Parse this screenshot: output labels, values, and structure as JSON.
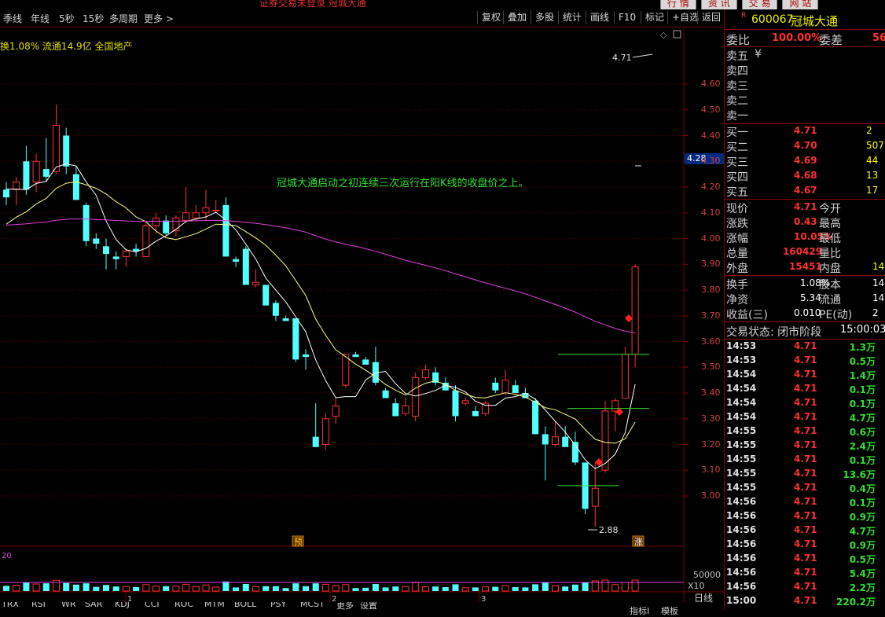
{
  "window": {
    "title": "证券交易未登录 冠城大通",
    "tabs": [
      "行 情",
      "资 讯",
      "交 易",
      "网 站"
    ]
  },
  "toolbar": {
    "periods": [
      "季线",
      "年线",
      "5秒",
      "15秒",
      "多周期",
      "更多 >"
    ],
    "buttons": [
      "复权",
      "叠加",
      "多股",
      "统计",
      "画线",
      "F10",
      "标记",
      "+自选",
      "返回"
    ]
  },
  "info_line": "换1.08% 流通14.9亿 全国地产",
  "annotation": "冠城大通启动之初连续三次运行在阳K线的收盘价之上。",
  "chart_data": {
    "type": "candlestick",
    "price_axis_ticks": [
      "4.60",
      "4.50",
      "4.40",
      "4.30",
      "4.20",
      "4.10",
      "4.00",
      "3.90",
      "3.80",
      "3.70",
      "3.60",
      "3.50",
      "3.40",
      "3.30",
      "3.20",
      "3.10",
      "3.00"
    ],
    "ylim": [
      2.85,
      4.72
    ],
    "current_price_label": "4.28",
    "high_marker": "4.71",
    "low_marker": "2.88",
    "candles": [
      {
        "o": 4.19,
        "h": 4.22,
        "l": 4.13,
        "c": 4.16
      },
      {
        "o": 4.19,
        "h": 4.24,
        "l": 4.13,
        "c": 4.22
      },
      {
        "o": 4.3,
        "h": 4.36,
        "l": 4.17,
        "c": 4.19
      },
      {
        "o": 4.22,
        "h": 4.33,
        "l": 4.18,
        "c": 4.3
      },
      {
        "o": 4.27,
        "h": 4.39,
        "l": 4.22,
        "c": 4.24
      },
      {
        "o": 4.26,
        "h": 4.52,
        "l": 4.25,
        "c": 4.44
      },
      {
        "o": 4.4,
        "h": 4.43,
        "l": 4.25,
        "c": 4.28
      },
      {
        "o": 4.25,
        "h": 4.28,
        "l": 4.15,
        "c": 4.15
      },
      {
        "o": 4.13,
        "h": 4.14,
        "l": 3.97,
        "c": 3.99
      },
      {
        "o": 4.0,
        "h": 4.02,
        "l": 3.96,
        "c": 3.98
      },
      {
        "o": 3.97,
        "h": 4.0,
        "l": 3.88,
        "c": 3.94
      },
      {
        "o": 3.93,
        "h": 3.95,
        "l": 3.88,
        "c": 3.92
      },
      {
        "o": 3.93,
        "h": 3.96,
        "l": 3.89,
        "c": 3.95
      },
      {
        "o": 3.96,
        "h": 3.98,
        "l": 3.93,
        "c": 3.95
      },
      {
        "o": 3.93,
        "h": 4.06,
        "l": 3.93,
        "c": 4.05
      },
      {
        "o": 4.05,
        "h": 4.1,
        "l": 4.02,
        "c": 4.08
      },
      {
        "o": 4.07,
        "h": 4.09,
        "l": 4.01,
        "c": 4.02
      },
      {
        "o": 4.03,
        "h": 4.09,
        "l": 4.01,
        "c": 4.08
      },
      {
        "o": 4.07,
        "h": 4.2,
        "l": 4.06,
        "c": 4.1
      },
      {
        "o": 4.08,
        "h": 4.13,
        "l": 4.07,
        "c": 4.1
      },
      {
        "o": 4.1,
        "h": 4.19,
        "l": 4.07,
        "c": 4.12
      },
      {
        "o": 4.11,
        "h": 4.15,
        "l": 4.1,
        "c": 4.11
      },
      {
        "o": 4.13,
        "h": 4.16,
        "l": 3.93,
        "c": 3.93
      },
      {
        "o": 3.92,
        "h": 3.93,
        "l": 3.89,
        "c": 3.91
      },
      {
        "o": 3.96,
        "h": 3.97,
        "l": 3.82,
        "c": 3.82
      },
      {
        "o": 3.82,
        "h": 3.88,
        "l": 3.81,
        "c": 3.83
      },
      {
        "o": 3.82,
        "h": 3.82,
        "l": 3.74,
        "c": 3.74
      },
      {
        "o": 3.75,
        "h": 3.76,
        "l": 3.68,
        "c": 3.7
      },
      {
        "o": 3.69,
        "h": 3.7,
        "l": 3.68,
        "c": 3.68
      },
      {
        "o": 3.69,
        "h": 3.69,
        "l": 3.52,
        "c": 3.53
      },
      {
        "o": 3.55,
        "h": 3.57,
        "l": 3.49,
        "c": 3.54
      },
      {
        "o": 3.23,
        "h": 3.36,
        "l": 3.19,
        "c": 3.19
      },
      {
        "o": 3.2,
        "h": 3.32,
        "l": 3.18,
        "c": 3.3
      },
      {
        "o": 3.31,
        "h": 3.38,
        "l": 3.28,
        "c": 3.35
      },
      {
        "o": 3.43,
        "h": 3.55,
        "l": 3.42,
        "c": 3.55
      },
      {
        "o": 3.55,
        "h": 3.56,
        "l": 3.54,
        "c": 3.54
      },
      {
        "o": 3.53,
        "h": 3.54,
        "l": 3.51,
        "c": 3.51
      },
      {
        "o": 3.52,
        "h": 3.58,
        "l": 3.43,
        "c": 3.44
      },
      {
        "o": 3.41,
        "h": 3.42,
        "l": 3.38,
        "c": 3.38
      },
      {
        "o": 3.36,
        "h": 3.38,
        "l": 3.31,
        "c": 3.31
      },
      {
        "o": 3.32,
        "h": 3.38,
        "l": 3.31,
        "c": 3.35
      },
      {
        "o": 3.31,
        "h": 3.48,
        "l": 3.29,
        "c": 3.46
      },
      {
        "o": 3.46,
        "h": 3.51,
        "l": 3.45,
        "c": 3.49
      },
      {
        "o": 3.48,
        "h": 3.5,
        "l": 3.43,
        "c": 3.44
      },
      {
        "o": 3.44,
        "h": 3.46,
        "l": 3.41,
        "c": 3.41
      },
      {
        "o": 3.41,
        "h": 3.43,
        "l": 3.29,
        "c": 3.31
      },
      {
        "o": 3.36,
        "h": 3.38,
        "l": 3.35,
        "c": 3.37
      },
      {
        "o": 3.33,
        "h": 3.35,
        "l": 3.31,
        "c": 3.31
      },
      {
        "o": 3.32,
        "h": 3.37,
        "l": 3.31,
        "c": 3.36
      },
      {
        "o": 3.44,
        "h": 3.46,
        "l": 3.4,
        "c": 3.41
      },
      {
        "o": 3.4,
        "h": 3.49,
        "l": 3.39,
        "c": 3.45
      },
      {
        "o": 3.43,
        "h": 3.45,
        "l": 3.4,
        "c": 3.4
      },
      {
        "o": 3.4,
        "h": 3.42,
        "l": 3.38,
        "c": 3.38
      },
      {
        "o": 3.37,
        "h": 3.38,
        "l": 3.24,
        "c": 3.24
      },
      {
        "o": 3.24,
        "h": 3.27,
        "l": 3.06,
        "c": 3.2
      },
      {
        "o": 3.2,
        "h": 3.29,
        "l": 3.19,
        "c": 3.23
      },
      {
        "o": 3.23,
        "h": 3.27,
        "l": 3.2,
        "c": 3.19
      },
      {
        "o": 3.21,
        "h": 3.25,
        "l": 3.12,
        "c": 3.13
      },
      {
        "o": 3.13,
        "h": 3.13,
        "l": 2.93,
        "c": 2.95
      },
      {
        "o": 2.96,
        "h": 3.13,
        "l": 2.88,
        "c": 3.03
      },
      {
        "o": 3.1,
        "h": 3.37,
        "l": 3.09,
        "c": 3.33
      },
      {
        "o": 3.33,
        "h": 3.38,
        "l": 3.25,
        "c": 3.37
      },
      {
        "o": 3.38,
        "h": 3.58,
        "l": 3.38,
        "c": 3.55
      },
      {
        "o": 3.55,
        "h": 3.9,
        "l": 3.5,
        "c": 3.89
      }
    ],
    "moving_averages": [
      {
        "name": "MA5",
        "color": "#ffffff"
      },
      {
        "name": "MA10",
        "color": "#ffff80"
      },
      {
        "name": "MA60",
        "color": "#e040e0"
      }
    ],
    "volume": {
      "ticks": [
        "50000",
        "X10"
      ],
      "label": "20"
    },
    "date_marks": [
      "1",
      "2",
      "3"
    ]
  },
  "markers": {
    "pre_label": "预",
    "rise_label": "涨"
  },
  "quote_panel": {
    "code": "600067",
    "name": "冠城大通",
    "r_mark": "R",
    "weibi": {
      "label": "委比",
      "value": "100.00%",
      "label2": "委差",
      "value2": "56"
    },
    "sell": [
      {
        "label": "卖五",
        "price": "¥",
        "vol": ""
      },
      {
        "label": "卖四",
        "price": "",
        "vol": ""
      },
      {
        "label": "卖三",
        "price": "",
        "vol": ""
      },
      {
        "label": "卖二",
        "price": "",
        "vol": ""
      },
      {
        "label": "卖一",
        "price": "",
        "vol": ""
      }
    ],
    "buy": [
      {
        "label": "买一",
        "price": "4.71",
        "vol": "2"
      },
      {
        "label": "买二",
        "price": "4.70",
        "vol": "507"
      },
      {
        "label": "买三",
        "price": "4.69",
        "vol": "44"
      },
      {
        "label": "买四",
        "price": "4.68",
        "vol": "13"
      },
      {
        "label": "买五",
        "price": "4.67",
        "vol": "17"
      }
    ],
    "stats": [
      {
        "k1": "现价",
        "v1": "4.71",
        "k2": "今开",
        "v2": ""
      },
      {
        "k1": "涨跌",
        "v1": "0.43",
        "k2": "最高",
        "v2": ""
      },
      {
        "k1": "涨幅",
        "v1": "10.05%",
        "k2": "最低",
        "v2": ""
      },
      {
        "k1": "总量",
        "v1": "160429",
        "k2": "量比",
        "v2": ""
      },
      {
        "k1": "外盘",
        "v1": "15451",
        "k2": "内盘",
        "v2": "14"
      }
    ],
    "stats2": [
      {
        "k1": "换手",
        "v1": "1.08%",
        "k2": "股本",
        "v2": "14"
      },
      {
        "k1": "净资",
        "v1": "5.34",
        "k2": "流通",
        "v2": "14"
      },
      {
        "k1": "收益(三)",
        "v1": "0.010",
        "k2": "PE(动)",
        "v2": "2"
      }
    ],
    "trade_status": {
      "label": "交易状态: 闭市阶段",
      "time": "15:00:03"
    },
    "ticks": [
      {
        "t": "14:53",
        "p": "4.71",
        "q": "1.3万"
      },
      {
        "t": "14:53",
        "p": "4.71",
        "q": "0.5万"
      },
      {
        "t": "14:54",
        "p": "4.71",
        "q": "1.4万"
      },
      {
        "t": "14:54",
        "p": "4.71",
        "q": "0.1万"
      },
      {
        "t": "14:54",
        "p": "4.71",
        "q": "0.1万"
      },
      {
        "t": "14:54",
        "p": "4.71",
        "q": "4.7万"
      },
      {
        "t": "14:55",
        "p": "4.71",
        "q": "0.6万"
      },
      {
        "t": "14:55",
        "p": "4.71",
        "q": "2.4万"
      },
      {
        "t": "14:55",
        "p": "4.71",
        "q": "0.1万"
      },
      {
        "t": "14:55",
        "p": "4.71",
        "q": "13.6万"
      },
      {
        "t": "14:55",
        "p": "4.71",
        "q": "0.4万"
      },
      {
        "t": "14:56",
        "p": "4.71",
        "q": "0.1万"
      },
      {
        "t": "14:56",
        "p": "4.71",
        "q": "0.9万"
      },
      {
        "t": "14:56",
        "p": "4.71",
        "q": "4.7万"
      },
      {
        "t": "14:56",
        "p": "4.71",
        "q": "0.9万"
      },
      {
        "t": "14:56",
        "p": "4.71",
        "q": "0.5万"
      },
      {
        "t": "14:56",
        "p": "4.71",
        "q": "5.4万"
      },
      {
        "t": "14:56",
        "p": "4.71",
        "q": "2.2万"
      },
      {
        "t": "15:00",
        "p": "4.71",
        "q": "220.2万"
      }
    ]
  },
  "bottom_tabs": [
    "TRX",
    "RSI",
    "WR",
    "SAR",
    "KDJ",
    "CCI",
    "ROC",
    "MTM",
    "BOLL",
    "PSY",
    "MCST",
    "更多",
    "设置"
  ],
  "bottom_right": [
    "指标Ⅰ",
    "模板",
    "日线"
  ],
  "colors": {
    "up": "#ff3030",
    "down": "#50ffff",
    "accent": "#f0f000",
    "green": "#30e030"
  }
}
